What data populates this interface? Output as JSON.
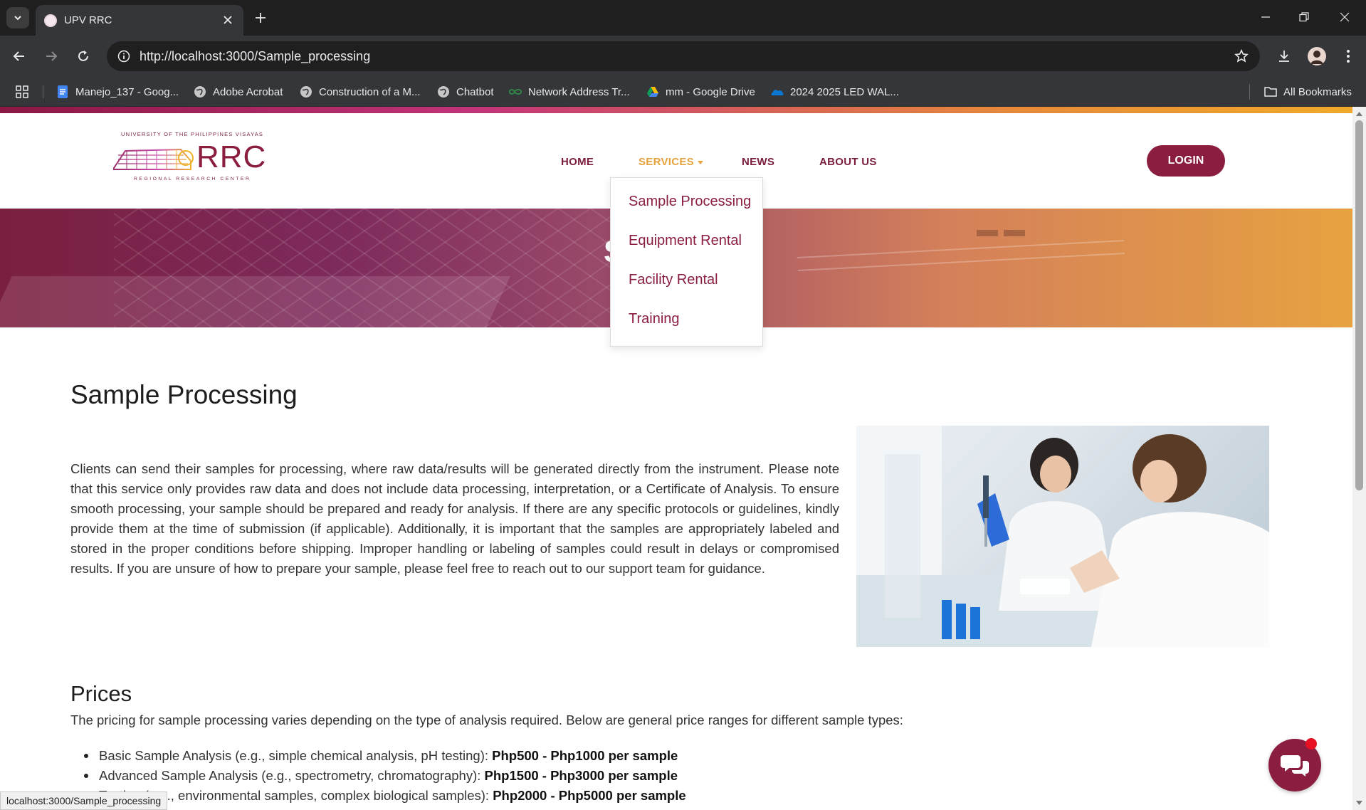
{
  "browser": {
    "tab_title": "UPV RRC",
    "url": "http://localhost:3000/Sample_processing",
    "bookmarks": [
      {
        "label": "Manejo_137 - Goog...",
        "icon": "docs-icon"
      },
      {
        "label": "Adobe Acrobat",
        "icon": "globe-icon"
      },
      {
        "label": "Construction of a M...",
        "icon": "globe-icon"
      },
      {
        "label": "Chatbot",
        "icon": "globe-icon"
      },
      {
        "label": "Network Address Tr...",
        "icon": "gfg-icon"
      },
      {
        "label": "mm - Google Drive",
        "icon": "drive-icon"
      },
      {
        "label": "2024 2025 LED WAL...",
        "icon": "onedrive-icon"
      }
    ],
    "all_bookmarks": "All Bookmarks",
    "status_url": "localhost:3000/Sample_processing"
  },
  "site": {
    "logo": {
      "top_text": "UNIVERSITY OF THE PHILIPPINES VISAYAS",
      "main_text": "RRC",
      "bottom_text": "REGIONAL RESEARCH CENTER"
    },
    "nav": {
      "home": "HOME",
      "services": "SERVICES",
      "news": "NEWS",
      "about": "ABOUT US"
    },
    "login": "LOGIN",
    "services_menu": [
      "Sample Processing",
      "Equipment Rental",
      "Facility Rental",
      "Training"
    ],
    "hero_letter": "S",
    "colors": {
      "brand": "#8b1d3f",
      "accent": "#e6a23c"
    }
  },
  "main": {
    "title": "Sample Processing",
    "intro": "Clients can send their samples for processing, where raw data/results will be generated directly from the instrument. Please note that this service only provides raw data and does not include data processing, interpretation, or a Certificate of Analysis. To ensure smooth processing, your sample should be prepared and ready for analysis. If there are any specific protocols or guidelines, kindly provide them at the time of submission (if applicable). Additionally, it is important that the samples are appropriately labeled and stored in the proper conditions before shipping. Improper handling or labeling of samples could result in delays or compromised results. If you are unsure of how to prepare your sample, please feel free to reach out to our support team for guidance.",
    "prices_title": "Prices",
    "prices_intro": "The pricing for sample processing varies depending on the type of analysis required. Below are general price ranges for different sample types:",
    "prices": [
      {
        "label": "Basic Sample Analysis (e.g., simple chemical analysis, pH testing): ",
        "price": "Php500 - Php1000 per sample"
      },
      {
        "label": "Advanced Sample Analysis (e.g., spectrometry, chromatography): ",
        "price": "Php1500 - Php3000 per sample"
      },
      {
        "label": "Testing (e.g., environmental samples, complex biological samples): ",
        "price": "Php2000 - Php5000 per sample"
      }
    ]
  }
}
